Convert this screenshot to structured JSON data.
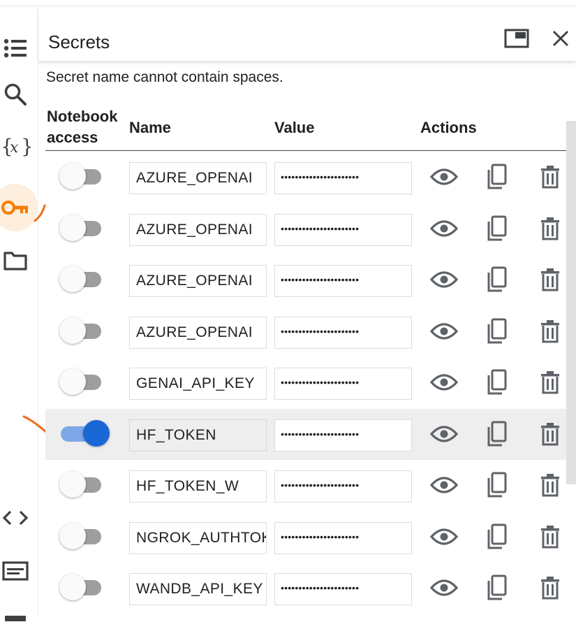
{
  "panel": {
    "title": "Secrets",
    "hint": "Secret name cannot contain spaces."
  },
  "columns": {
    "notebook_access_line1": "Notebook",
    "notebook_access_line2": "access",
    "name": "Name",
    "value": "Value",
    "actions": "Actions"
  },
  "secrets": [
    {
      "name": "AZURE_OPENAI",
      "value": "••••••••••••••••••••••",
      "access": false
    },
    {
      "name": "AZURE_OPENAI",
      "value": "••••••••••••••••••••••",
      "access": false
    },
    {
      "name": "AZURE_OPENAI",
      "value": "••••••••••••••••••••••",
      "access": false
    },
    {
      "name": "AZURE_OPENAI",
      "value": "••••••••••••••••••••••",
      "access": false
    },
    {
      "name": "GENAI_API_KEY",
      "value": "••••••••••••••••••••••",
      "access": false
    },
    {
      "name": "HF_TOKEN",
      "value": "••••••••••••••••••••••",
      "access": true
    },
    {
      "name": "HF_TOKEN_W",
      "value": "••••••••••••••••••••••",
      "access": false
    },
    {
      "name": "NGROK_AUTHTOKEN",
      "value": "••••••••••••••••••••••",
      "access": false
    },
    {
      "name": "WANDB_API_KEY",
      "value": "••••••••••••••••••••••",
      "access": false
    }
  ],
  "icons": {
    "rail": [
      "toc-icon",
      "search-icon",
      "variables-icon",
      "key-icon",
      "folder-icon",
      "code-icon",
      "terminal-icon"
    ],
    "header": [
      "open-in-tab-icon",
      "close-icon"
    ],
    "row_actions": [
      "visibility-icon",
      "copy-icon",
      "delete-icon"
    ]
  },
  "colors": {
    "accent_orange": "#f57c00",
    "toggle_on": "#1a67d6",
    "annotation": "#f26a1b"
  }
}
